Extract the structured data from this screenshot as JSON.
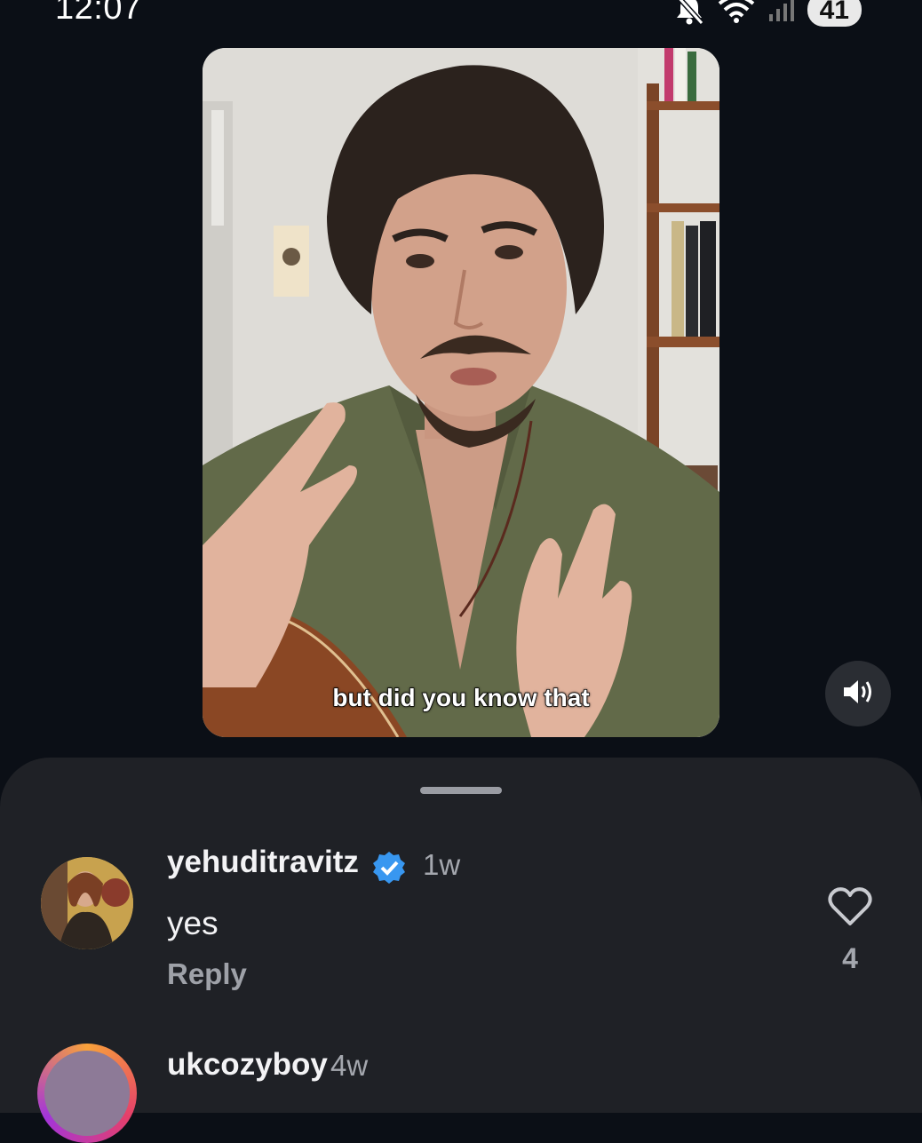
{
  "status_bar": {
    "time": "12:07",
    "battery": "41",
    "icons": [
      "mute-icon",
      "wifi-icon",
      "signal-icon"
    ]
  },
  "video": {
    "caption": "but did you know that",
    "sound_icon": "speaker-icon"
  },
  "comments": [
    {
      "username": "yehuditravitz",
      "verified": true,
      "time": "1w",
      "text": "yes",
      "reply_label": "Reply",
      "likes": "4"
    },
    {
      "username": "ukcozyboy",
      "time": "4w"
    }
  ],
  "colors": {
    "background": "#0b0f16",
    "sheet": "#1f2126",
    "verified_blue": "#3897f0",
    "muted_text": "#a4a7ae"
  }
}
